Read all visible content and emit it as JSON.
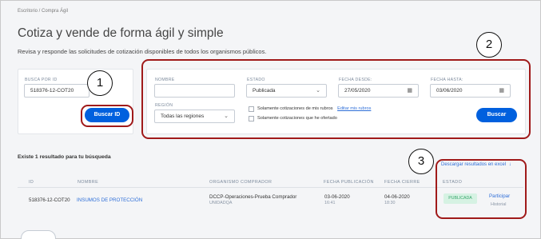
{
  "breadcrumb": "Escritorio  /  Compra Ágil",
  "title": "Cotiza y vende de forma ágil y simple",
  "subtitle": "Revisa y responde las solicitudes de cotización disponibles de todos los organismos públicos.",
  "search_by_id": {
    "label": "BUSCA POR ID",
    "value": "518376-12-COT20",
    "button": "Buscar ID"
  },
  "filters": {
    "nombre_label": "NOMBRE",
    "nombre_value": "",
    "estado_label": "ESTADO",
    "estado_value": "Publicada",
    "fecha_desde_label": "FECHA DESDE:",
    "fecha_desde_value": "27/05/2020",
    "fecha_hasta_label": "FECHA HASTA:",
    "fecha_hasta_value": "03/06/2020",
    "region_label": "REGIÓN",
    "region_value": "Todas las regiones",
    "checkbox_rubros": "Solamente cotizaciones de mis rubros",
    "editar_rubros": "Editar mis rubros",
    "checkbox_ofertado": "Solamente cotizaciones que he ofertado",
    "search_button": "Buscar"
  },
  "results": {
    "count_text": "Existe 1 resultado para tu búsqueda",
    "excel_link": "Descargar resultados en excel",
    "columns": [
      "ID",
      "NOMBRE",
      "ORGANISMO COMPRADOR",
      "FECHA PUBLICACIÓN",
      "FECHA CIERRE",
      "ESTADO"
    ],
    "rows": [
      {
        "id": "518376-12-COT20",
        "nombre": "INSUMOS DE PROTECCIÓN",
        "organismo": "DCCP-Operaciones-Prueba Comprador",
        "unidad": "UNIDADQA",
        "pub_date": "03-06-2020",
        "pub_time": "16:41",
        "cierre_date": "04-06-2020",
        "cierre_time": "18:30",
        "estado": "PUBLICADA",
        "action_primary": "Participar",
        "action_secondary": "Historial"
      }
    ]
  },
  "annotations": [
    "1",
    "2",
    "3"
  ],
  "colors": {
    "primary_button": "#0060de",
    "annotation_border": "#a01a1a",
    "badge_bg": "#d6f2e3",
    "badge_text": "#37a66c",
    "link": "#2f6fd8"
  }
}
